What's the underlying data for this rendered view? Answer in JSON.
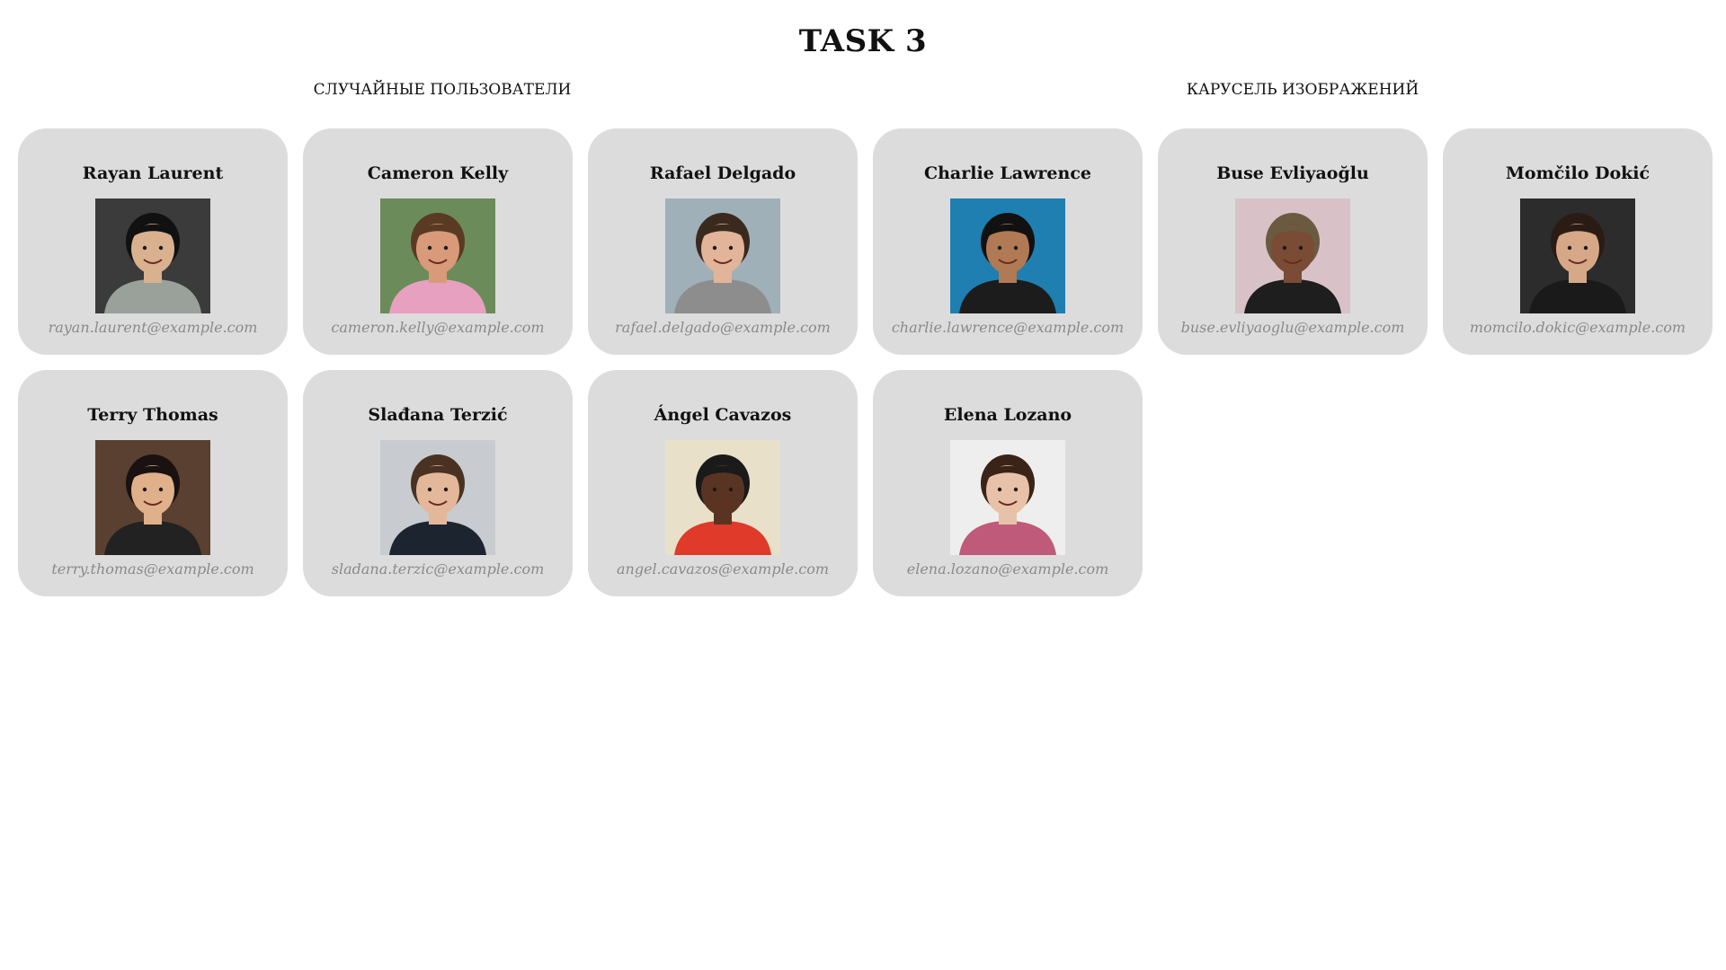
{
  "page": {
    "title": "TASK 3",
    "section_users": "Случайные пользователи",
    "section_carousel": "Карусель изображений"
  },
  "users": [
    {
      "name": "Rayan Laurent",
      "email": "rayan.laurent@example.com",
      "avatar_icon": "person-photo-icon",
      "bg": "#3b3b3b",
      "skin": "#d9b18e",
      "hair": "#111111",
      "shirt": "#9aa09a"
    },
    {
      "name": "Cameron Kelly",
      "email": "cameron.kelly@example.com",
      "avatar_icon": "person-photo-icon",
      "bg": "#6b8c5a",
      "skin": "#d99a7a",
      "hair": "#5a3a22",
      "shirt": "#e8a0c0"
    },
    {
      "name": "Rafael Delgado",
      "email": "rafael.delgado@example.com",
      "avatar_icon": "person-photo-icon",
      "bg": "#9fb0b8",
      "skin": "#e2b49a",
      "hair": "#3a2a1e",
      "shirt": "#8d8d8d"
    },
    {
      "name": "Charlie Lawrence",
      "email": "charlie.lawrence@example.com",
      "avatar_icon": "person-photo-icon",
      "bg": "#1f7fb0",
      "skin": "#b07a55",
      "hair": "#111111",
      "shirt": "#1c1c1c"
    },
    {
      "name": "Buse Evliyaoğlu",
      "email": "buse.evliyaoglu@example.com",
      "avatar_icon": "person-photo-icon",
      "bg": "#d8c2c8",
      "skin": "#7a4b35",
      "hair": "#6a5a40",
      "shirt": "#1e1e1e"
    },
    {
      "name": "Momčilo Dokić",
      "email": "momcilo.dokic@example.com",
      "avatar_icon": "person-photo-icon",
      "bg": "#2c2c2c",
      "skin": "#d6a888",
      "hair": "#2a1c14",
      "shirt": "#1a1a1a"
    },
    {
      "name": "Terry Thomas",
      "email": "terry.thomas@example.com",
      "avatar_icon": "person-photo-icon",
      "bg": "#5a4030",
      "skin": "#e0b08a",
      "hair": "#1a1210",
      "shirt": "#222222"
    },
    {
      "name": "Slađana Terzić",
      "email": "sladana.terzic@example.com",
      "avatar_icon": "person-photo-icon",
      "bg": "#c8ccd0",
      "skin": "#e3b89a",
      "hair": "#4a3222",
      "shirt": "#1c2430"
    },
    {
      "name": "Ángel Cavazos",
      "email": "angel.cavazos@example.com",
      "avatar_icon": "person-photo-icon",
      "bg": "#e8e0c8",
      "skin": "#5a3422",
      "hair": "#1a1a1a",
      "shirt": "#e03a2a"
    },
    {
      "name": "Elena Lozano",
      "email": "elena.lozano@example.com",
      "avatar_icon": "person-photo-icon",
      "bg": "#eeeeee",
      "skin": "#e8c2a8",
      "hair": "#3a2418",
      "shirt": "#c05a7a"
    }
  ]
}
